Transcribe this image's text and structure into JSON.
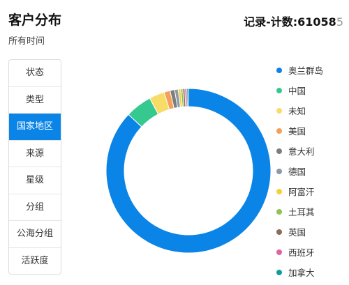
{
  "header": {
    "title": "客户分布",
    "subtitle": "所有时间",
    "record_label": "记录-计数:",
    "record_value": "61058",
    "record_suffix": "5"
  },
  "tabs": [
    {
      "label": "状态"
    },
    {
      "label": "类型"
    },
    {
      "label": "国家地区",
      "active": true
    },
    {
      "label": "来源"
    },
    {
      "label": "星级"
    },
    {
      "label": "分组"
    },
    {
      "label": "公海分组"
    },
    {
      "label": "活跃度"
    }
  ],
  "chart_data": {
    "type": "pie",
    "donut": true,
    "legend_position": "right",
    "series": [
      {
        "name": "奥兰群岛",
        "value": 87.0,
        "color": "#0a84e6"
      },
      {
        "name": "中国",
        "value": 5.2,
        "color": "#35c98f"
      },
      {
        "name": "未知",
        "value": 3.0,
        "color": "#f8dc68"
      },
      {
        "name": "美国",
        "value": 1.2,
        "color": "#f5a05a"
      },
      {
        "name": "意大利",
        "value": 0.9,
        "color": "#7d7d7d"
      },
      {
        "name": "德国",
        "value": 0.7,
        "color": "#8a9aa8"
      },
      {
        "name": "阿富汗",
        "value": 0.5,
        "color": "#f2d13b"
      },
      {
        "name": "土耳其",
        "value": 0.4,
        "color": "#8fc153"
      },
      {
        "name": "英国",
        "value": 0.4,
        "color": "#8c6a5c"
      },
      {
        "name": "西班牙",
        "value": 0.4,
        "color": "#e063a6"
      },
      {
        "name": "加拿大",
        "value": 0.3,
        "color": "#139b9b"
      }
    ]
  }
}
